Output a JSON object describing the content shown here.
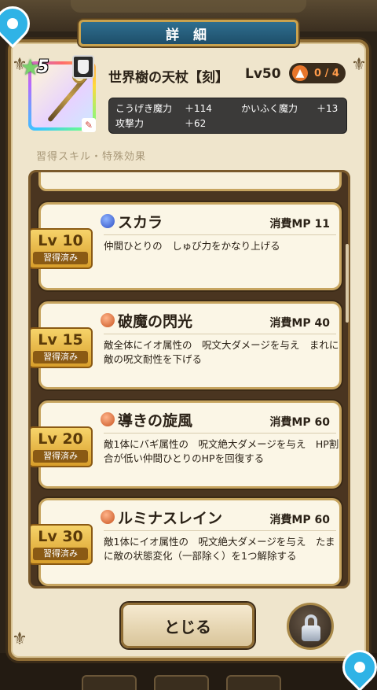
{
  "dialog": {
    "title": "詳 細"
  },
  "item": {
    "name": "世界樹の天杖【刻】",
    "level": "Lv50",
    "rarity": "5",
    "upgrade": "0 / 4",
    "stats": [
      {
        "label": "こうげき魔力",
        "value": "＋114",
        "label2": "かいふく魔力",
        "value2": "＋13"
      },
      {
        "label": "攻撃力",
        "value": "＋62",
        "label2": "",
        "value2": ""
      }
    ]
  },
  "section_label": "習得スキル・特殊効果",
  "skills": [
    {
      "lv": "Lv 10",
      "learned": "習得済み",
      "name": "スカラ",
      "mp": "消費MP 11",
      "desc": "仲間ひとりの　しゅび力をかなり上げる",
      "icon": "blue"
    },
    {
      "lv": "Lv 15",
      "learned": "習得済み",
      "name": "破魔の閃光",
      "mp": "消費MP 40",
      "desc": "敵全体にイオ属性の　呪文大ダメージを与え　まれに敵の呪文耐性を下げる",
      "icon": "orange"
    },
    {
      "lv": "Lv 20",
      "learned": "習得済み",
      "name": "導きの旋風",
      "mp": "消費MP 60",
      "desc": "敵1体にバギ属性の　呪文絶大ダメージを与え　HP割合が低い仲間ひとりのHPを回復する",
      "icon": "orange"
    },
    {
      "lv": "Lv 30",
      "learned": "習得済み",
      "name": "ルミナスレイン",
      "mp": "消費MP 60",
      "desc": "敵1体にイオ属性の　呪文絶大ダメージを与え　たまに敵の状態変化（一部除く）を1つ解除する",
      "icon": "orange"
    }
  ],
  "buttons": {
    "close": "とじる"
  },
  "icons": {
    "lock": "lock-icon",
    "pin": "map-pin-icon"
  }
}
